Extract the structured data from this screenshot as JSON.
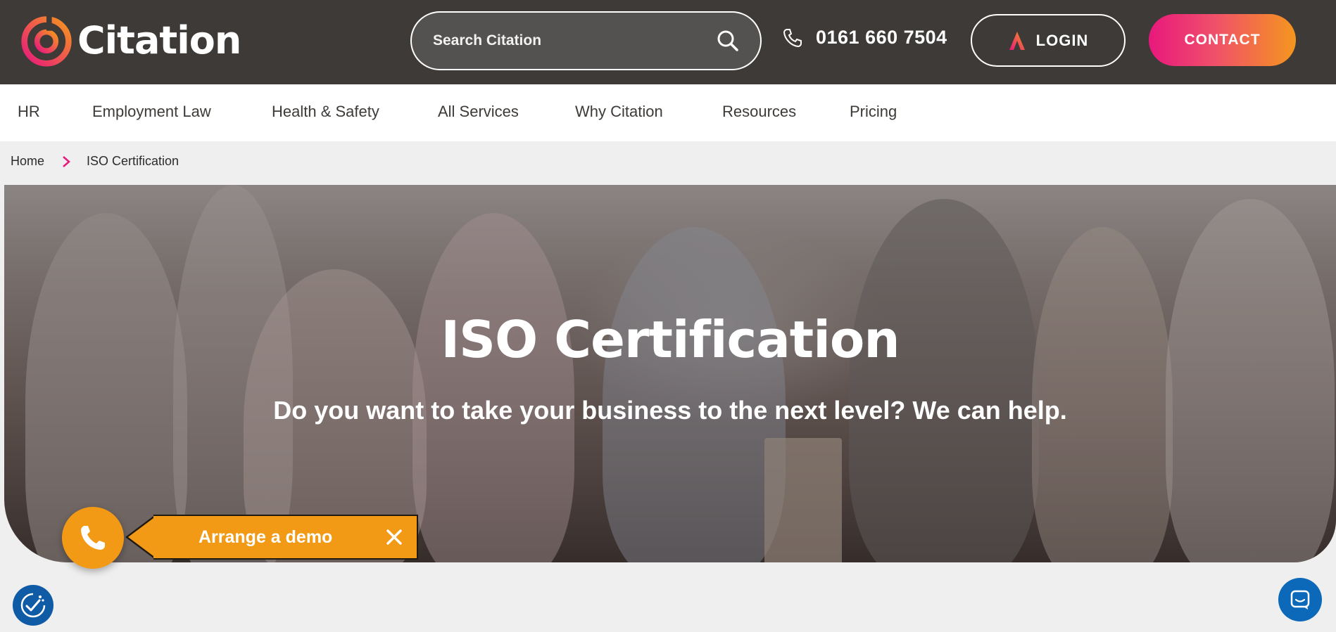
{
  "brand": {
    "name": "Citation"
  },
  "search": {
    "placeholder": "Search Citation"
  },
  "header": {
    "phone": "0161 660 7504",
    "login_label": "LOGIN",
    "contact_label": "CONTACT"
  },
  "nav": {
    "items": [
      "HR",
      "Employment Law",
      "Health & Safety",
      "All Services",
      "Why Citation",
      "Resources",
      "Pricing"
    ]
  },
  "breadcrumb": {
    "home": "Home",
    "current": "ISO Certification"
  },
  "hero": {
    "title": "ISO Certification",
    "subtitle": "Do you want to take your business to the next level? We can help."
  },
  "demo": {
    "label": "Arrange a demo"
  },
  "colors": {
    "topbar": "#3d3a37",
    "accent_pink": "#e8187d",
    "accent_orange": "#f5961e",
    "demo_orange": "#f29a15",
    "chat_blue": "#0c68b9"
  },
  "icons": {
    "search": "search-icon",
    "phone": "phone-icon",
    "login": "login-logo-icon",
    "breadcrumb_separator": "chevron-right-icon",
    "demo_phone": "phone-icon",
    "demo_close": "close-icon",
    "accessibility": "accessibility-icon",
    "chat": "chat-icon"
  }
}
